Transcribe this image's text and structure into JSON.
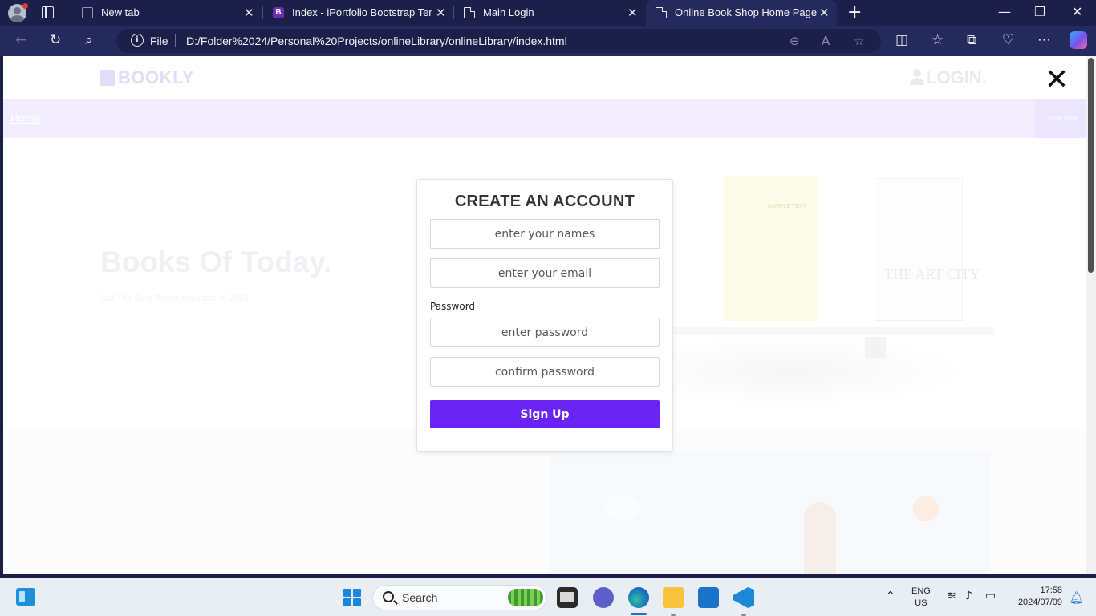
{
  "browser": {
    "tabs": [
      {
        "title": "New tab",
        "active": false
      },
      {
        "title": "Index - iPortfolio Bootstrap Temp",
        "active": false
      },
      {
        "title": "Main Login",
        "active": false
      },
      {
        "title": "Online Book Shop Home Page",
        "active": true
      }
    ],
    "address": {
      "scheme_label": "File",
      "url": "D:/Folder%2024/Personal%20Projects/onlineLibrary/onlineLibrary/index.html"
    }
  },
  "site": {
    "logo": "BOOKLY",
    "login": "LOGIN.",
    "close_symbol": "✕",
    "nav": {
      "home": "Home",
      "shop_now": "Shop Now"
    },
    "hero": {
      "title": "Books Of Today.",
      "subtitle": "Get The Best Books Available In 2024."
    },
    "art": {
      "yellow_book_text": "SAMPLE TEXT",
      "art_book_title": "THE ART CITY"
    }
  },
  "modal": {
    "title": "CREATE AN ACCOUNT",
    "names_placeholder": "enter your names",
    "email_placeholder": "enter your email",
    "password_label": "Password",
    "password_placeholder": "enter password",
    "confirm_placeholder": "confirm password",
    "submit": "Sign Up",
    "accent": "#6a25f4"
  },
  "taskbar": {
    "search": "Search",
    "lang_top": "ENG",
    "lang_bottom": "US",
    "time": "17:58",
    "date": "2024/07/09"
  }
}
